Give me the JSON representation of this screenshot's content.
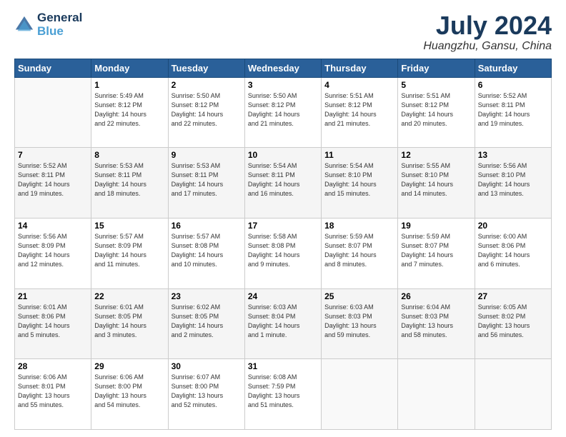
{
  "header": {
    "logo_line1": "General",
    "logo_line2": "Blue",
    "month_year": "July 2024",
    "location": "Huangzhu, Gansu, China"
  },
  "weekdays": [
    "Sunday",
    "Monday",
    "Tuesday",
    "Wednesday",
    "Thursday",
    "Friday",
    "Saturday"
  ],
  "weeks": [
    [
      {
        "day": "",
        "info": ""
      },
      {
        "day": "1",
        "info": "Sunrise: 5:49 AM\nSunset: 8:12 PM\nDaylight: 14 hours\nand 22 minutes."
      },
      {
        "day": "2",
        "info": "Sunrise: 5:50 AM\nSunset: 8:12 PM\nDaylight: 14 hours\nand 22 minutes."
      },
      {
        "day": "3",
        "info": "Sunrise: 5:50 AM\nSunset: 8:12 PM\nDaylight: 14 hours\nand 21 minutes."
      },
      {
        "day": "4",
        "info": "Sunrise: 5:51 AM\nSunset: 8:12 PM\nDaylight: 14 hours\nand 21 minutes."
      },
      {
        "day": "5",
        "info": "Sunrise: 5:51 AM\nSunset: 8:12 PM\nDaylight: 14 hours\nand 20 minutes."
      },
      {
        "day": "6",
        "info": "Sunrise: 5:52 AM\nSunset: 8:11 PM\nDaylight: 14 hours\nand 19 minutes."
      }
    ],
    [
      {
        "day": "7",
        "info": "Sunrise: 5:52 AM\nSunset: 8:11 PM\nDaylight: 14 hours\nand 19 minutes."
      },
      {
        "day": "8",
        "info": "Sunrise: 5:53 AM\nSunset: 8:11 PM\nDaylight: 14 hours\nand 18 minutes."
      },
      {
        "day": "9",
        "info": "Sunrise: 5:53 AM\nSunset: 8:11 PM\nDaylight: 14 hours\nand 17 minutes."
      },
      {
        "day": "10",
        "info": "Sunrise: 5:54 AM\nSunset: 8:11 PM\nDaylight: 14 hours\nand 16 minutes."
      },
      {
        "day": "11",
        "info": "Sunrise: 5:54 AM\nSunset: 8:10 PM\nDaylight: 14 hours\nand 15 minutes."
      },
      {
        "day": "12",
        "info": "Sunrise: 5:55 AM\nSunset: 8:10 PM\nDaylight: 14 hours\nand 14 minutes."
      },
      {
        "day": "13",
        "info": "Sunrise: 5:56 AM\nSunset: 8:10 PM\nDaylight: 14 hours\nand 13 minutes."
      }
    ],
    [
      {
        "day": "14",
        "info": "Sunrise: 5:56 AM\nSunset: 8:09 PM\nDaylight: 14 hours\nand 12 minutes."
      },
      {
        "day": "15",
        "info": "Sunrise: 5:57 AM\nSunset: 8:09 PM\nDaylight: 14 hours\nand 11 minutes."
      },
      {
        "day": "16",
        "info": "Sunrise: 5:57 AM\nSunset: 8:08 PM\nDaylight: 14 hours\nand 10 minutes."
      },
      {
        "day": "17",
        "info": "Sunrise: 5:58 AM\nSunset: 8:08 PM\nDaylight: 14 hours\nand 9 minutes."
      },
      {
        "day": "18",
        "info": "Sunrise: 5:59 AM\nSunset: 8:07 PM\nDaylight: 14 hours\nand 8 minutes."
      },
      {
        "day": "19",
        "info": "Sunrise: 5:59 AM\nSunset: 8:07 PM\nDaylight: 14 hours\nand 7 minutes."
      },
      {
        "day": "20",
        "info": "Sunrise: 6:00 AM\nSunset: 8:06 PM\nDaylight: 14 hours\nand 6 minutes."
      }
    ],
    [
      {
        "day": "21",
        "info": "Sunrise: 6:01 AM\nSunset: 8:06 PM\nDaylight: 14 hours\nand 5 minutes."
      },
      {
        "day": "22",
        "info": "Sunrise: 6:01 AM\nSunset: 8:05 PM\nDaylight: 14 hours\nand 3 minutes."
      },
      {
        "day": "23",
        "info": "Sunrise: 6:02 AM\nSunset: 8:05 PM\nDaylight: 14 hours\nand 2 minutes."
      },
      {
        "day": "24",
        "info": "Sunrise: 6:03 AM\nSunset: 8:04 PM\nDaylight: 14 hours\nand 1 minute."
      },
      {
        "day": "25",
        "info": "Sunrise: 6:03 AM\nSunset: 8:03 PM\nDaylight: 13 hours\nand 59 minutes."
      },
      {
        "day": "26",
        "info": "Sunrise: 6:04 AM\nSunset: 8:03 PM\nDaylight: 13 hours\nand 58 minutes."
      },
      {
        "day": "27",
        "info": "Sunrise: 6:05 AM\nSunset: 8:02 PM\nDaylight: 13 hours\nand 56 minutes."
      }
    ],
    [
      {
        "day": "28",
        "info": "Sunrise: 6:06 AM\nSunset: 8:01 PM\nDaylight: 13 hours\nand 55 minutes."
      },
      {
        "day": "29",
        "info": "Sunrise: 6:06 AM\nSunset: 8:00 PM\nDaylight: 13 hours\nand 54 minutes."
      },
      {
        "day": "30",
        "info": "Sunrise: 6:07 AM\nSunset: 8:00 PM\nDaylight: 13 hours\nand 52 minutes."
      },
      {
        "day": "31",
        "info": "Sunrise: 6:08 AM\nSunset: 7:59 PM\nDaylight: 13 hours\nand 51 minutes."
      },
      {
        "day": "",
        "info": ""
      },
      {
        "day": "",
        "info": ""
      },
      {
        "day": "",
        "info": ""
      }
    ]
  ]
}
